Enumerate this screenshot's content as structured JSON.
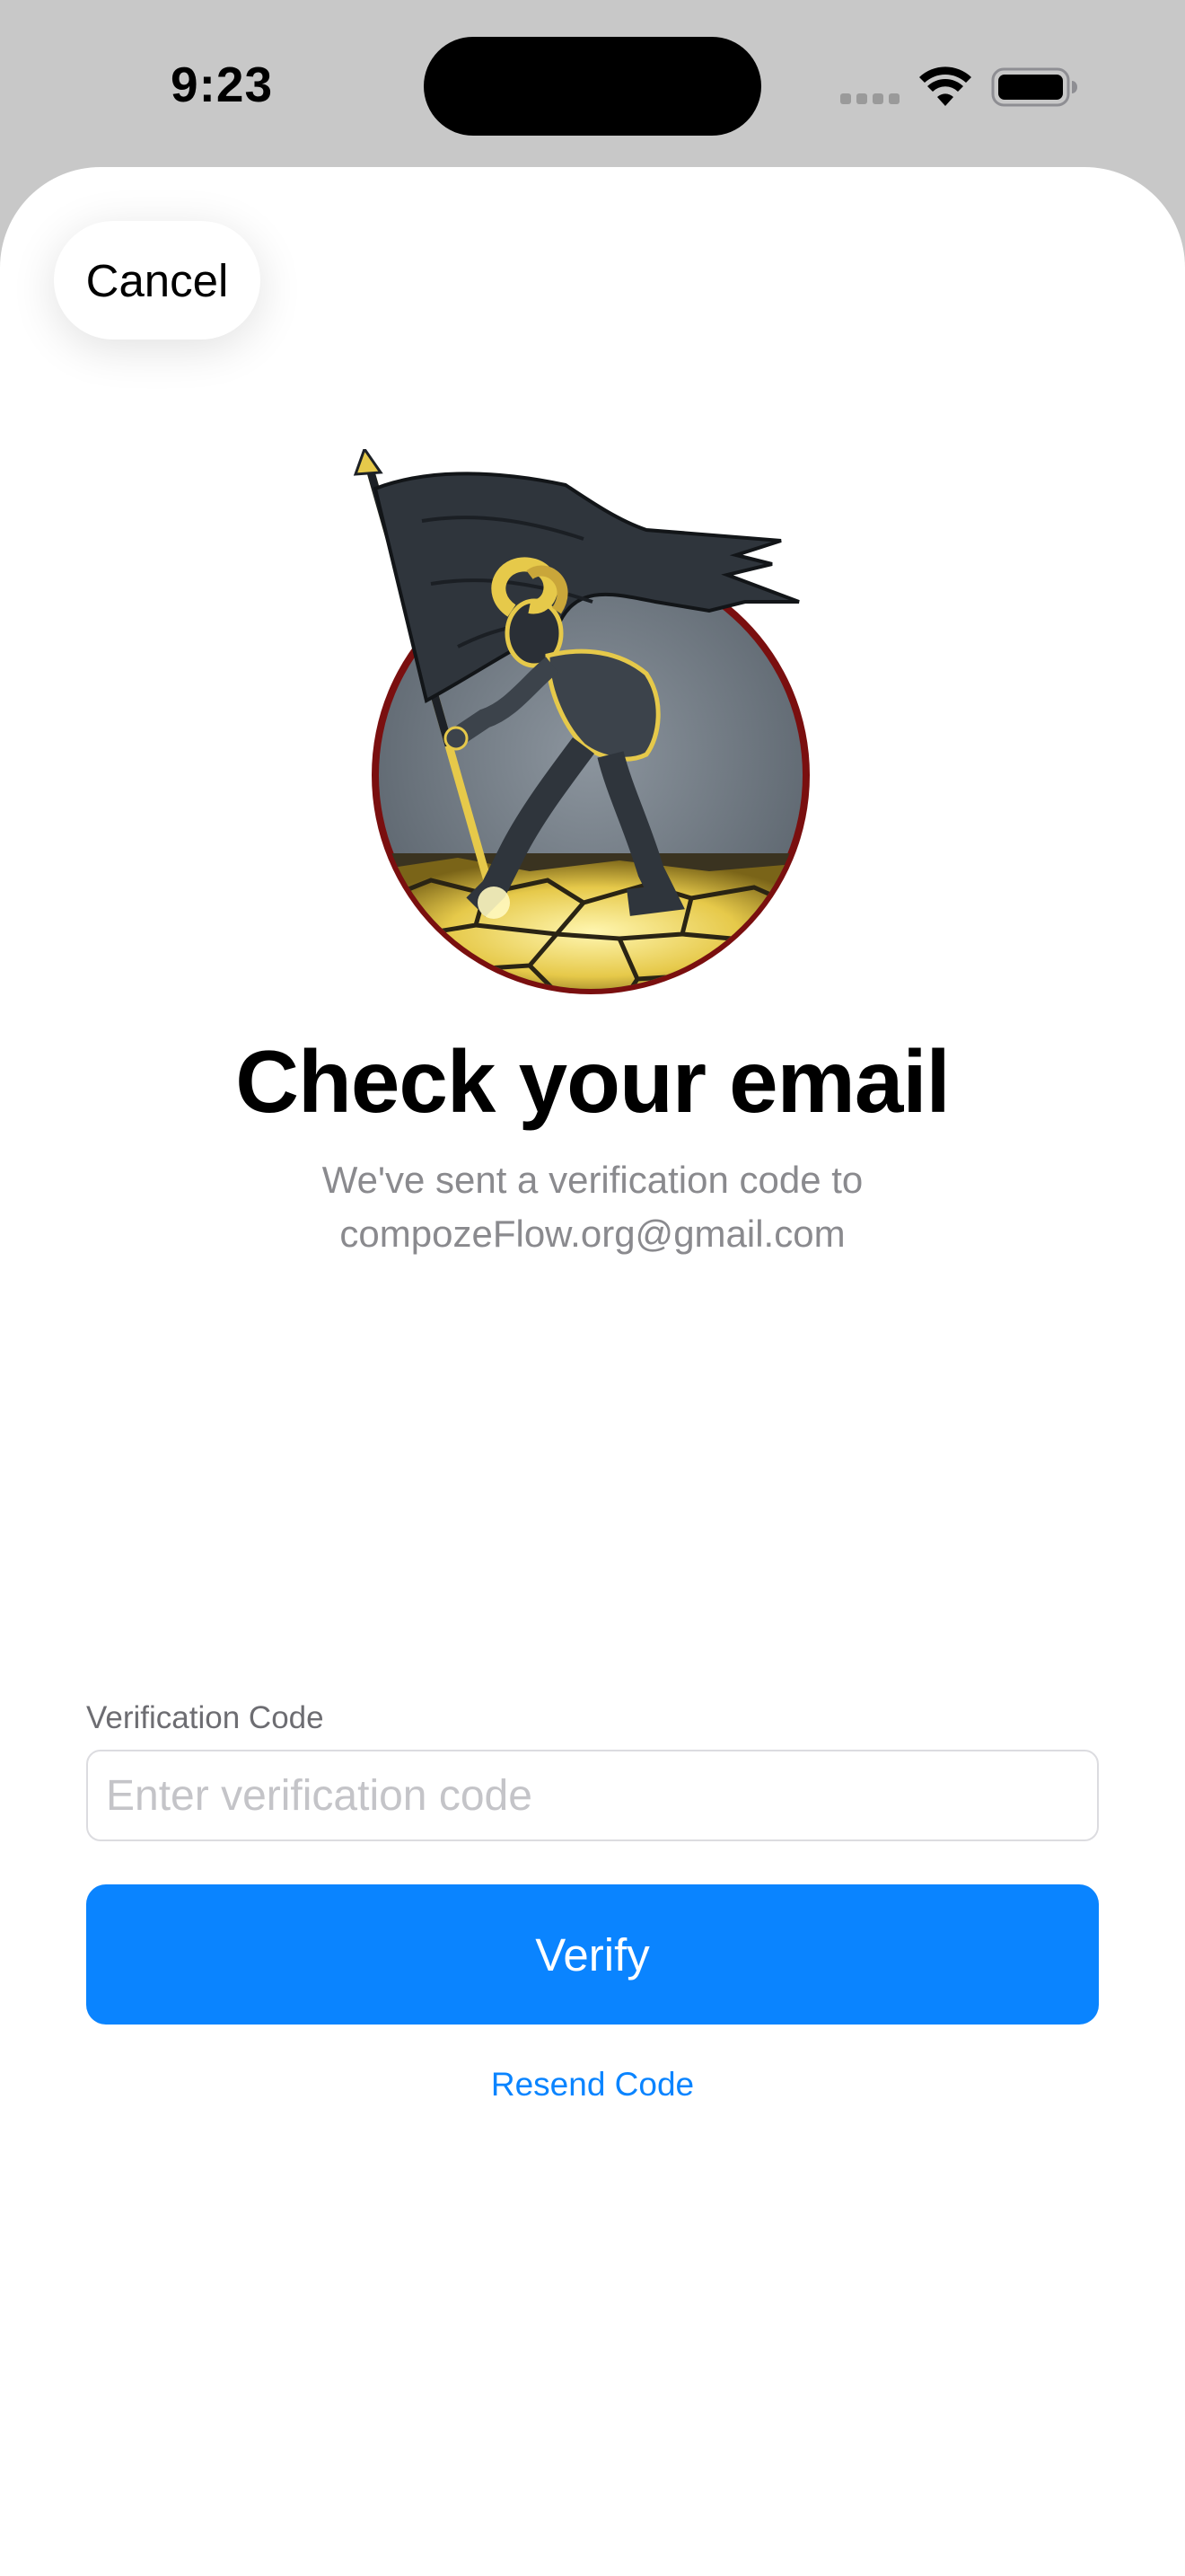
{
  "status_bar": {
    "time": "9:23",
    "icons": [
      "cellular-signal-icon",
      "wifi-icon",
      "battery-icon"
    ]
  },
  "header": {
    "cancel_label": "Cancel"
  },
  "hero": {
    "logo_icon": "ram-flag-bearer-logo-icon",
    "title": "Check your email",
    "subtitle_line1": "We've sent a verification code to",
    "email": "compozeFlow.org@gmail.com"
  },
  "form": {
    "code_label": "Verification Code",
    "code_value": "",
    "code_placeholder": "Enter verification code",
    "verify_label": "Verify",
    "resend_label": "Resend Code"
  },
  "colors": {
    "accent": "#0a84ff",
    "background": "#ffffff",
    "status_bar_background": "#c8c8c8",
    "logo_ring": "#7a0f0f",
    "logo_gold": "#e6c94a",
    "logo_dark": "#2f353c"
  }
}
